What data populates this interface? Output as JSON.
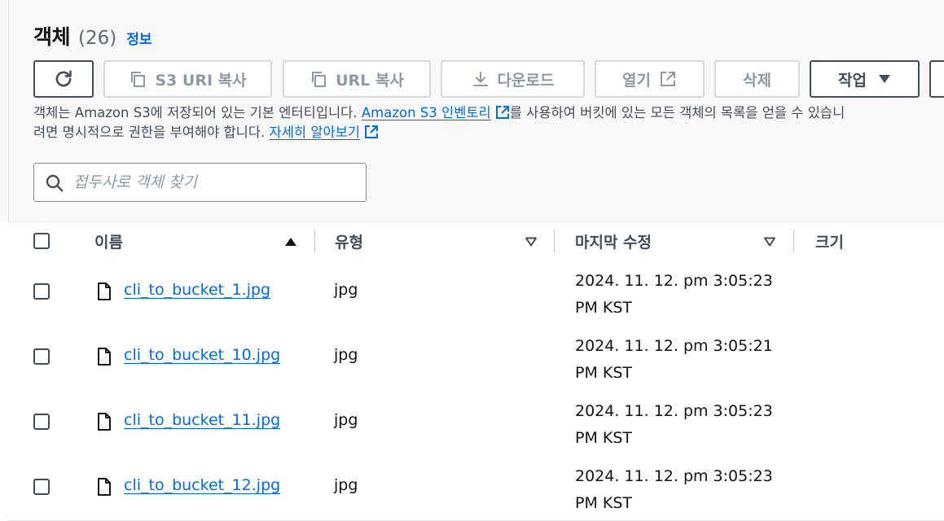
{
  "header": {
    "title": "객체",
    "count": "(26)",
    "info_link": "정보"
  },
  "toolbar": {
    "refresh_icon": "refresh-icon",
    "copy_s3_uri": "S3 URI 복사",
    "copy_url": "URL 복사",
    "download": "다운로드",
    "open": "열기",
    "delete": "삭제",
    "actions": "작업"
  },
  "description": {
    "text1": "객체는 Amazon S3에 저장되어 있는 기본 엔터티입니다.",
    "link1": "Amazon S3 인벤토리",
    "text2": "를 사용하여 버킷에 있는 모든 객체의 목록을 얻을 수 있습니",
    "text3": "려면 명시적으로 권한을 부여해야 합니다.",
    "link2": "자세히 알아보기"
  },
  "search": {
    "placeholder": "접두사로 객체 찾기",
    "value": ""
  },
  "table": {
    "columns": {
      "name": "이름",
      "type": "유형",
      "modified": "마지막 수정",
      "size": "크기"
    },
    "rows": [
      {
        "name": "cli_to_bucket_1.jpg",
        "type": "jpg",
        "modified": "2024. 11. 12. pm 3:05:23 PM KST"
      },
      {
        "name": "cli_to_bucket_10.jpg",
        "type": "jpg",
        "modified": "2024. 11. 12. pm 3:05:21 PM KST"
      },
      {
        "name": "cli_to_bucket_11.jpg",
        "type": "jpg",
        "modified": "2024. 11. 12. pm 3:05:23 PM KST"
      },
      {
        "name": "cli_to_bucket_12.jpg",
        "type": "jpg",
        "modified": "2024. 11. 12. pm 3:05:23 PM KST"
      }
    ]
  },
  "colors": {
    "link": "#006ce0",
    "text": "#0f141a",
    "muted": "#5f6b7a",
    "disabled": "#8d99a8",
    "border": "#d5dbdb",
    "panel_bg": "#f8f8f8"
  }
}
